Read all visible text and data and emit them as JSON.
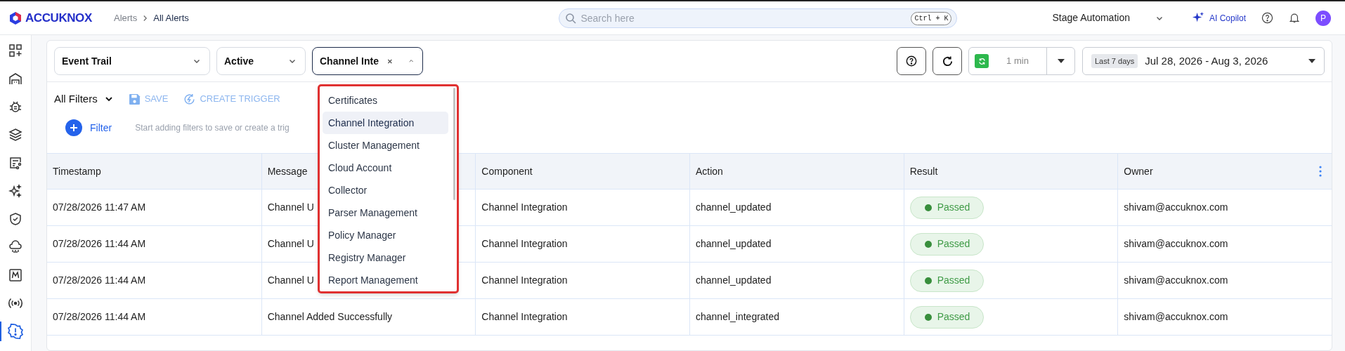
{
  "header": {
    "logo": "ACCUKNOX",
    "breadcrumb": [
      {
        "label": "Alerts",
        "selected": false
      },
      {
        "label": "All Alerts",
        "selected": true
      }
    ],
    "search": {
      "placeholder": "Search here",
      "shortcut": "Ctrl + K"
    },
    "workspace": "Stage Automation",
    "copilot": "AI Copilot",
    "avatar": "P"
  },
  "sidebar": {
    "items": [
      {
        "selected": false
      },
      {
        "selected": false
      },
      {
        "selected": false
      },
      {
        "selected": false
      },
      {
        "selected": false
      },
      {
        "selected": false
      },
      {
        "selected": false
      },
      {
        "selected": false
      },
      {
        "selected": false
      },
      {
        "selected": false
      },
      {
        "selected": true
      }
    ]
  },
  "toolbar": {
    "selects": [
      {
        "value": "Event Trail",
        "expanded": false,
        "clearable": false
      },
      {
        "value": "Active",
        "expanded": false,
        "clearable": false
      },
      {
        "value": "Channel Inte",
        "expanded": true,
        "clearable": true
      }
    ],
    "interval": "1 min",
    "date_range": {
      "preset": "Last 7 days",
      "value": "Jul 28, 2026 - Aug 3, 2026"
    }
  },
  "filter_bar": {
    "title": "All Filters",
    "actions": [
      {
        "label": "SAVE",
        "disabled": true
      },
      {
        "label": "CREATE TRIGGER",
        "disabled": true
      }
    ],
    "add_filter": "Filter",
    "hint": "Start adding filters to save or create a trig"
  },
  "table": {
    "columns": [
      "Timestamp",
      "Message",
      "Component",
      "Action",
      "Result",
      "Owner"
    ],
    "rows": [
      {
        "timestamp": "07/28/2026 11:47 AM",
        "message": "Channel U",
        "component": "Channel Integration",
        "action": "channel_updated",
        "result": "Passed",
        "owner": "shivam@accuknox.com"
      },
      {
        "timestamp": "07/28/2026 11:44 AM",
        "message": "Channel U",
        "component": "Channel Integration",
        "action": "channel_updated",
        "result": "Passed",
        "owner": "shivam@accuknox.com"
      },
      {
        "timestamp": "07/28/2026 11:44 AM",
        "message": "Channel U",
        "component": "Channel Integration",
        "action": "channel_updated",
        "result": "Passed",
        "owner": "shivam@accuknox.com"
      },
      {
        "timestamp": "07/28/2026 11:44 AM",
        "message": "Channel Added Successfully",
        "component": "Channel Integration",
        "action": "channel_integrated",
        "result": "Passed",
        "owner": "shivam@accuknox.com"
      }
    ]
  },
  "dropdown": {
    "options": [
      {
        "label": "Certificates",
        "selected": false
      },
      {
        "label": "Channel Integration",
        "selected": true
      },
      {
        "label": "Cluster Management",
        "selected": false
      },
      {
        "label": "Cloud Account",
        "selected": false
      },
      {
        "label": "Collector",
        "selected": false
      },
      {
        "label": "Parser Management",
        "selected": false
      },
      {
        "label": "Policy Manager",
        "selected": false
      },
      {
        "label": "Registry Manager",
        "selected": false
      },
      {
        "label": "Report Management",
        "selected": false
      }
    ]
  }
}
